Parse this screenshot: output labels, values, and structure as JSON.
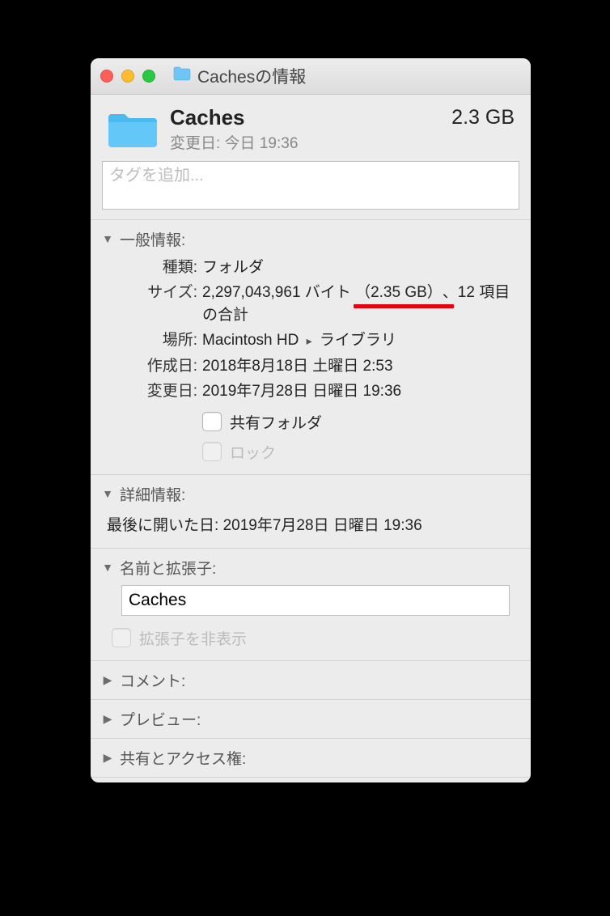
{
  "titlebar": {
    "title": "Cachesの情報"
  },
  "header": {
    "name": "Caches",
    "modified_label": "変更日: 今日 19:36",
    "size_short": "2.3 GB"
  },
  "tags": {
    "placeholder": "タグを追加..."
  },
  "sections": {
    "general": {
      "title": "一般情報:",
      "kind_label": "種類:",
      "kind_value": "フォルダ",
      "size_label": "サイズ:",
      "size_bytes": "2,297,043,961 バイト",
      "size_paren": "（2.35 GB）",
      "size_tail": "、12 項目の合計",
      "where_label": "場所:",
      "where_root": "Macintosh HD",
      "where_child": "ライブラリ",
      "created_label": "作成日:",
      "created_value": "2018年8月18日 土曜日 2:53",
      "modified_label": "変更日:",
      "modified_value": "2019年7月28日 日曜日 19:36",
      "shared_label": "共有フォルダ",
      "locked_label": "ロック"
    },
    "more": {
      "title": "詳細情報:",
      "last_opened_label": "最後に開いた日:",
      "last_opened_value": "2019年7月28日 日曜日 19:36"
    },
    "name_ext": {
      "title": "名前と拡張子:",
      "value": "Caches",
      "hide_ext_label": "拡張子を非表示"
    },
    "comments": {
      "title": "コメント:"
    },
    "preview": {
      "title": "プレビュー:"
    },
    "sharing": {
      "title": "共有とアクセス権:"
    }
  }
}
